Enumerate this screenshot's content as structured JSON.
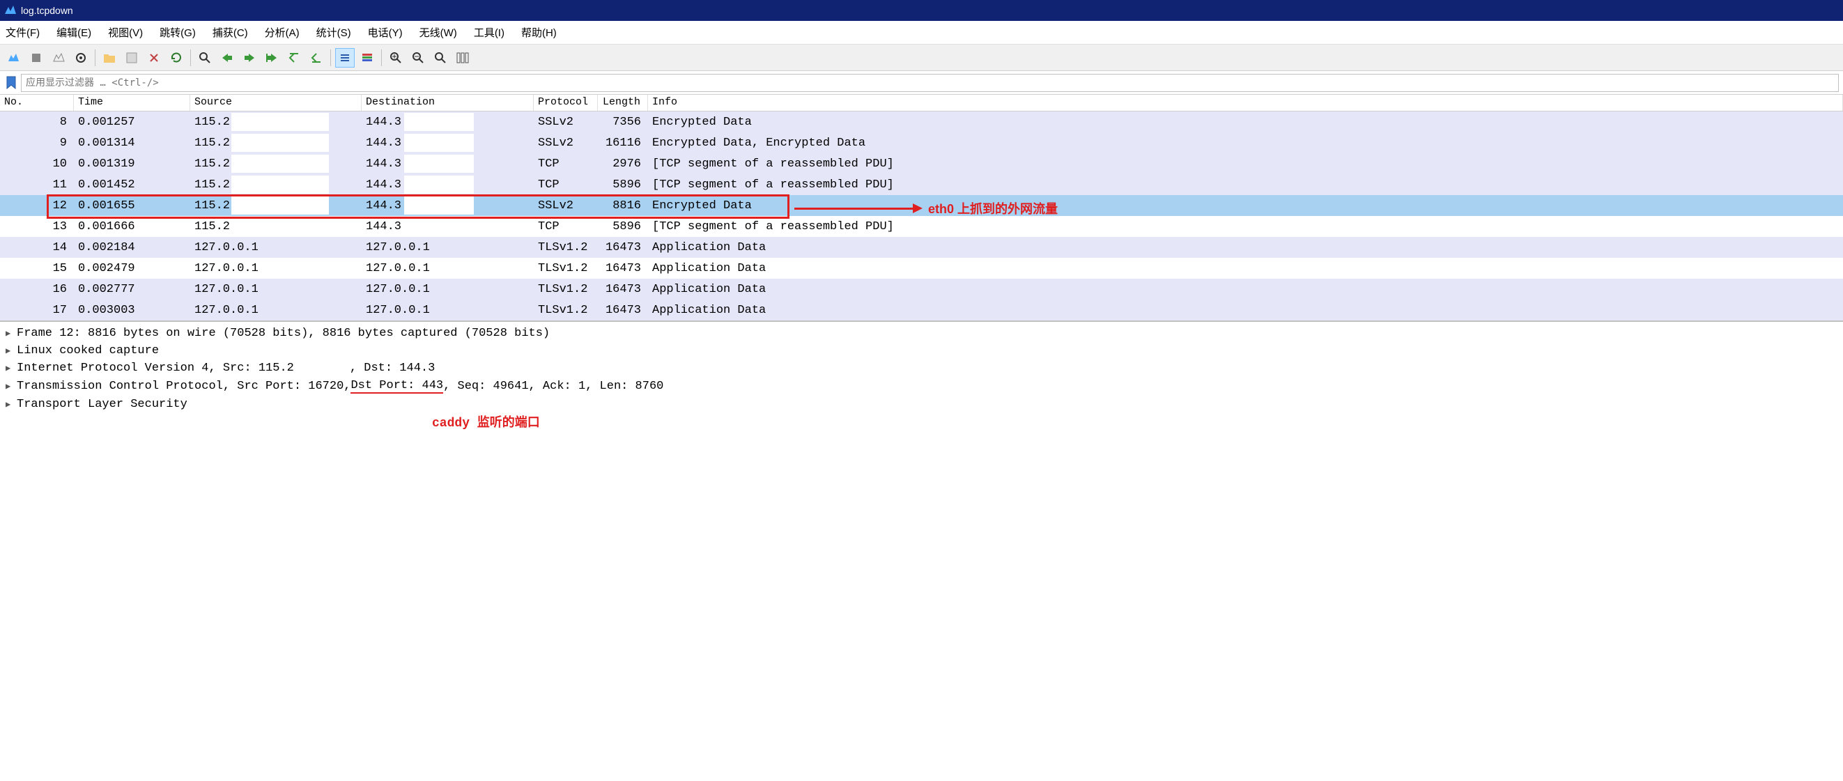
{
  "window": {
    "title": "log.tcpdown"
  },
  "menu": {
    "file": "文件(F)",
    "edit": "编辑(E)",
    "view": "视图(V)",
    "go": "跳转(G)",
    "capture": "捕获(C)",
    "analyze": "分析(A)",
    "statistics": "统计(S)",
    "telephony": "电话(Y)",
    "wireless": "无线(W)",
    "tools": "工具(I)",
    "help": "帮助(H)"
  },
  "filter": {
    "placeholder": "应用显示过滤器 … <Ctrl-/>"
  },
  "columns": {
    "no": "No.",
    "time": "Time",
    "source": "Source",
    "destination": "Destination",
    "protocol": "Protocol",
    "length": "Length",
    "info": "Info"
  },
  "packets": [
    {
      "no": "8",
      "time": "0.001257",
      "src": "115.2",
      "dst": "144.3",
      "proto": "SSLv2",
      "len": "7356",
      "info": "Encrypted Data",
      "bg": "lavender",
      "masked": true
    },
    {
      "no": "9",
      "time": "0.001314",
      "src": "115.2",
      "dst": "144.3",
      "proto": "SSLv2",
      "len": "16116",
      "info": "Encrypted Data, Encrypted Data",
      "bg": "lavender",
      "masked": true
    },
    {
      "no": "10",
      "time": "0.001319",
      "src": "115.2",
      "dst": "144.3",
      "proto": "TCP",
      "len": "2976",
      "info": "[TCP segment of a reassembled PDU]",
      "bg": "lavender",
      "masked": true
    },
    {
      "no": "11",
      "time": "0.001452",
      "src": "115.2",
      "dst": "144.3",
      "proto": "TCP",
      "len": "5896",
      "info": "[TCP segment of a reassembled PDU]",
      "bg": "lavender",
      "masked": true
    },
    {
      "no": "12",
      "time": "0.001655",
      "src": "115.2",
      "dst": "144.3",
      "proto": "SSLv2",
      "len": "8816",
      "info": "Encrypted Data",
      "bg": "selected",
      "masked": true,
      "highlighted": true
    },
    {
      "no": "13",
      "time": "0.001666",
      "src": "115.2",
      "dst": "144.3",
      "proto": "TCP",
      "len": "5896",
      "info": "[TCP segment of a reassembled PDU]",
      "bg": "white",
      "masked": true
    },
    {
      "no": "14",
      "time": "0.002184",
      "src": "127.0.0.1",
      "dst": "127.0.0.1",
      "proto": "TLSv1.2",
      "len": "16473",
      "info": "Application Data",
      "bg": "lavender",
      "masked": false
    },
    {
      "no": "15",
      "time": "0.002479",
      "src": "127.0.0.1",
      "dst": "127.0.0.1",
      "proto": "TLSv1.2",
      "len": "16473",
      "info": "Application Data",
      "bg": "white",
      "masked": false
    },
    {
      "no": "16",
      "time": "0.002777",
      "src": "127.0.0.1",
      "dst": "127.0.0.1",
      "proto": "TLSv1.2",
      "len": "16473",
      "info": "Application Data",
      "bg": "lavender",
      "masked": false
    },
    {
      "no": "17",
      "time": "0.003003",
      "src": "127.0.0.1",
      "dst": "127.0.0.1",
      "proto": "TLSv1.2",
      "len": "16473",
      "info": "Application Data",
      "bg": "lavender",
      "masked": false
    }
  ],
  "annotations": {
    "eth0": "eth0 上抓到的外网流量",
    "caddy": "caddy 监听的端口"
  },
  "details": {
    "frame": "Frame 12: 8816 bytes on wire (70528 bits), 8816 bytes captured (70528 bits)",
    "linux": "Linux cooked capture",
    "ip_pre": "Internet Protocol Version 4, Src: 115.2",
    "ip_post": ", Dst: 144.3",
    "tcp_pre": "Transmission Control Protocol, Src Port: 16720, ",
    "tcp_underlined": "Dst Port: 443",
    "tcp_post": ", Seq: 49641, Ack: 1, Len: 8760",
    "tls": "Transport Layer Security"
  }
}
